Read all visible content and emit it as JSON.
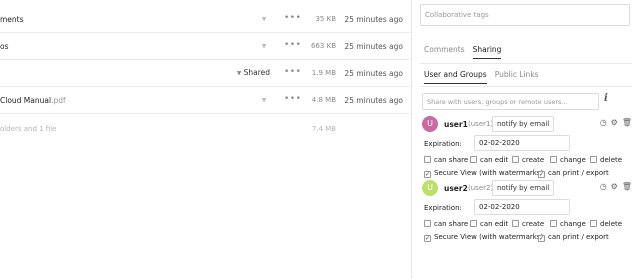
{
  "files": [
    {
      "name": "ments",
      "ext": "",
      "share_label": "",
      "size": "35 KB",
      "time": "25 minutes ago"
    },
    {
      "name": "os",
      "ext": "",
      "share_label": "",
      "size": "663 KB",
      "time": "25 minutes ago"
    },
    {
      "name": "",
      "ext": "",
      "share_label": "Shared",
      "size": "1.9 MB",
      "time": "25 minutes ago"
    },
    {
      "name": "Cloud Manual",
      "ext": ".pdf",
      "share_label": "",
      "size": "4.8 MB",
      "time": "25 minutes ago"
    }
  ],
  "summary": {
    "text": "olders and 1 file",
    "size": "7.4 MB"
  },
  "sidebar": {
    "tags_placeholder": "Collaborative tags",
    "tabs": [
      "Comments",
      "Sharing"
    ],
    "subtabs": [
      "User and Groups",
      "Public Links"
    ],
    "search_placeholder": "Share with users, groups or remote users...",
    "info_icon": "i",
    "users": [
      {
        "avatar_letter": "U",
        "avatar_color": "#c96aa3",
        "name": "user1",
        "id": "(user1)",
        "notify": "notify by email",
        "expiration_label": "Expiration:",
        "expiration": "02-02-2020",
        "perms": [
          "can share",
          "can edit",
          "create",
          "change",
          "delete"
        ],
        "perms2": [
          "Secure View (with watermarks)",
          "can print / export"
        ]
      },
      {
        "avatar_letter": "U",
        "avatar_color": "#bde06a",
        "name": "user2",
        "id": "(user2)",
        "notify": "notify by email",
        "expiration_label": "Expiration:",
        "expiration": "02-02-2020",
        "perms": [
          "can share",
          "can edit",
          "create",
          "change",
          "delete"
        ],
        "perms2": [
          "Secure View (with watermarks)",
          "can print / export"
        ]
      }
    ]
  }
}
